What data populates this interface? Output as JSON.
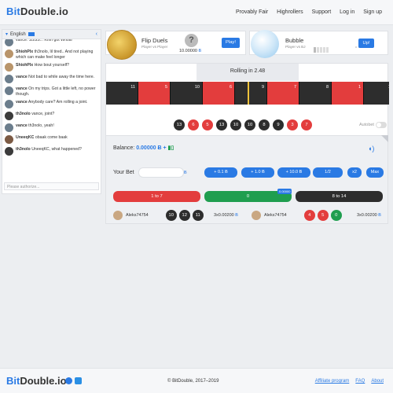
{
  "header": {
    "logo_bit": "Bit",
    "logo_rest": "Double.io",
    "nav": [
      "Provably Fair",
      "Highrollers",
      "Support",
      "Log in",
      "Sign up"
    ]
  },
  "chat": {
    "language": "English",
    "messages": [
      {
        "user": "",
        "text": "vance: SSSS... Khm got Whoa!"
      },
      {
        "user": "ShiohPlx",
        "text": "th3nolo, lil tired.. And not playing which can make feel longer"
      },
      {
        "user": "ShiohPlx",
        "text": "How bout yourself?"
      },
      {
        "user": "vance",
        "text": "Not bad to while away the time here."
      },
      {
        "user": "vance",
        "text": "On my trips. Got a little left, no power though."
      },
      {
        "user": "vance",
        "text": "Anybody care? Am rolling a joint."
      },
      {
        "user": "th3nolo",
        "text": "vance, joint?"
      },
      {
        "user": "vance",
        "text": "th3nolo, yeah!"
      },
      {
        "user": "UneeqKC",
        "text": "obaak come baak"
      },
      {
        "user": "th3nolo",
        "text": "UneeqKC, what happened?"
      }
    ],
    "input_placeholder": "Please authorize..."
  },
  "cards": {
    "flip": {
      "title": "Flip Duels",
      "subtitle": "Player vs Player",
      "amount": "10.00000",
      "button": "Play!"
    },
    "bubble": {
      "title": "Bubble",
      "subtitle": "Player vs BJ",
      "button": "Up!"
    }
  },
  "roulette": {
    "rolling": "Rolling in 2.48",
    "strip": [
      {
        "n": "11",
        "c": "black"
      },
      {
        "n": "5",
        "c": "red"
      },
      {
        "n": "10",
        "c": "black"
      },
      {
        "n": "6",
        "c": "red"
      },
      {
        "n": "9",
        "c": "black"
      },
      {
        "n": "7",
        "c": "red"
      },
      {
        "n": "8",
        "c": "black"
      },
      {
        "n": "1",
        "c": "red"
      },
      {
        "n": "14",
        "c": "black"
      }
    ],
    "history": [
      {
        "n": "13",
        "c": "b"
      },
      {
        "n": "6",
        "c": "r"
      },
      {
        "n": "5",
        "c": "r"
      },
      {
        "n": "13",
        "c": "b"
      },
      {
        "n": "10",
        "c": "b"
      },
      {
        "n": "10",
        "c": "b"
      },
      {
        "n": "8",
        "c": "b"
      },
      {
        "n": "9",
        "c": "b"
      },
      {
        "n": "3",
        "c": "r"
      },
      {
        "n": "7",
        "c": "r"
      }
    ],
    "autobet": "Autobet"
  },
  "bet": {
    "balance_label": "Balance:",
    "balance_value": "0.00000",
    "your_bet": "Your Bet",
    "buttons": [
      "+ 0.1",
      "+ 1.0",
      "+ 10.0",
      "1/2",
      "x2",
      "Max"
    ],
    "place": [
      "1 to 7",
      "0",
      "8 to 14"
    ],
    "mult": "0.00000"
  },
  "players": [
    {
      "name": "Aleks74754",
      "balls": [
        {
          "n": "10",
          "c": "b"
        },
        {
          "n": "12",
          "c": "b"
        },
        {
          "n": "11",
          "c": "b"
        }
      ],
      "amount": "3x0.00200"
    },
    {
      "name": "Aleks74754",
      "balls": [
        {
          "n": "4",
          "c": "r"
        },
        {
          "n": "5",
          "c": "r"
        },
        {
          "n": "0",
          "c": "g"
        }
      ],
      "amount": "3x0.00200"
    }
  ],
  "footer": {
    "logo_bit": "Bit",
    "logo_rest": "Double.io",
    "copyright": "© BitDouble, 2017–2019",
    "links": [
      "Affiliate program",
      "FAQ",
      "About"
    ]
  },
  "colors": {
    "accent": "#2a7ae4",
    "red": "#e33d3d",
    "green": "#1f9e4f",
    "black": "#2d2d2d"
  },
  "icons": {
    "sound": "speaker-icon",
    "collapse": "chevron-left-icon",
    "telegram": "telegram-icon",
    "twitter": "twitter-icon"
  }
}
